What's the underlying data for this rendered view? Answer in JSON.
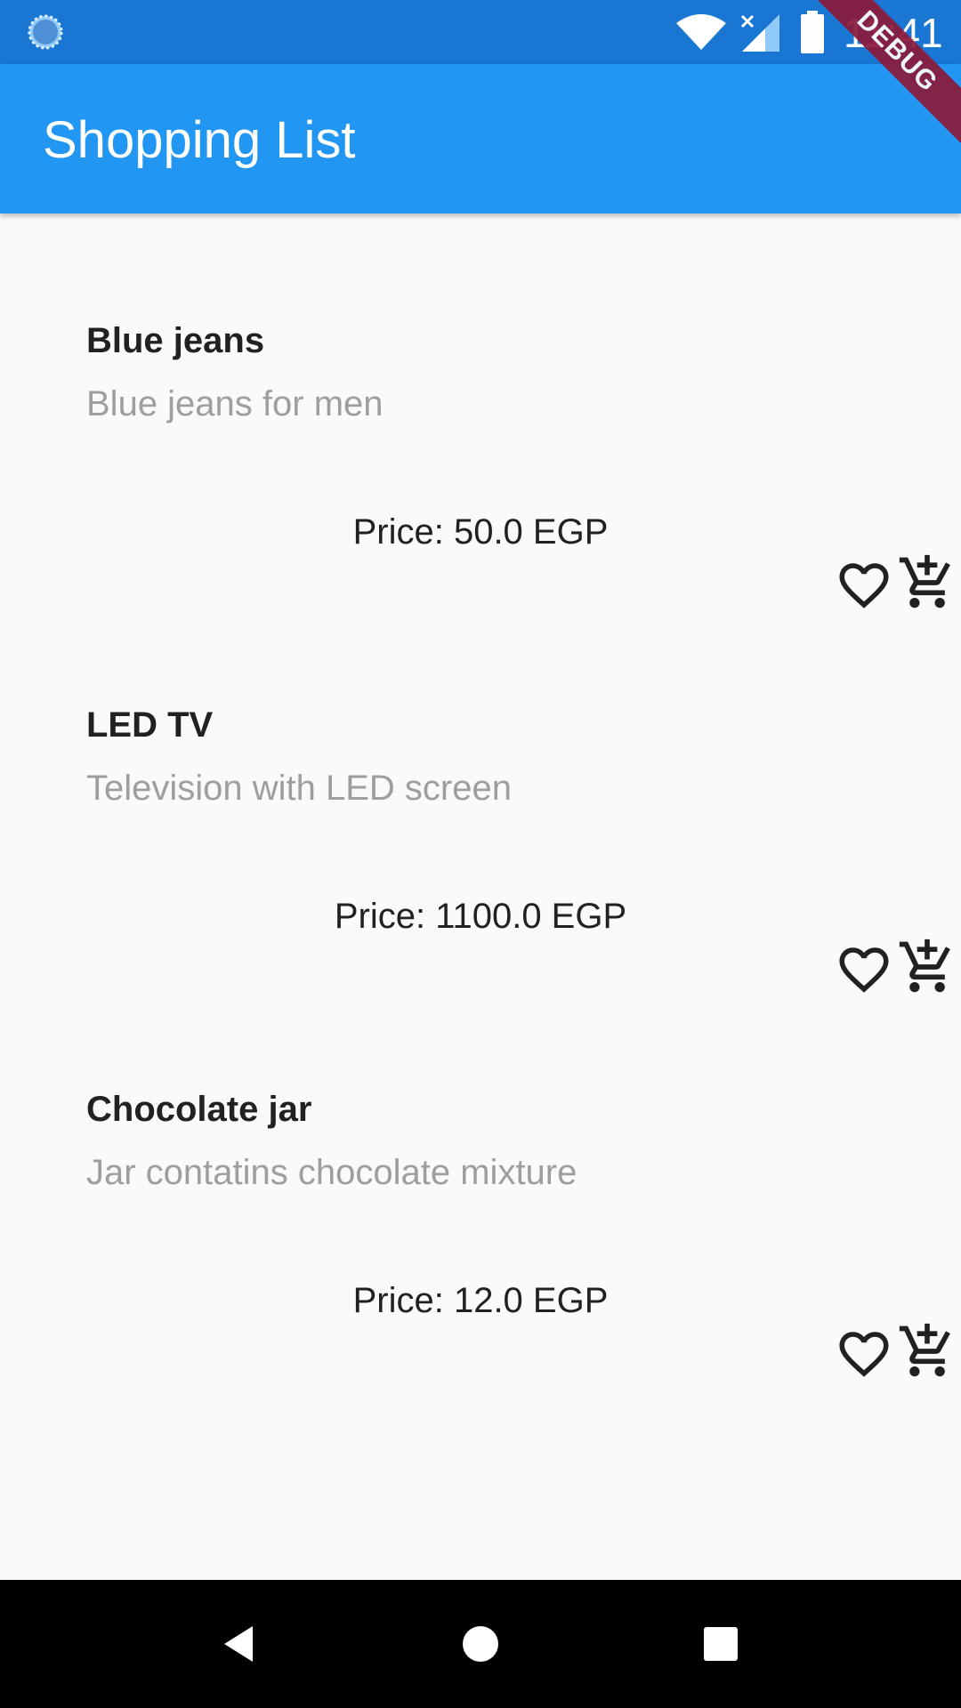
{
  "status_bar": {
    "time": "11:41",
    "icons": [
      "loader-icon",
      "wifi-icon",
      "signal-icon",
      "battery-icon"
    ]
  },
  "debug_banner": {
    "label": "DEBUG"
  },
  "app_bar": {
    "title": "Shopping List",
    "color": "#2196f3"
  },
  "products": [
    {
      "name": "Blue jeans",
      "description": "Blue jeans for men",
      "price": "Price: 50.0 EGP"
    },
    {
      "name": "LED TV",
      "description": "Television with LED screen",
      "price": "Price: 1100.0 EGP"
    },
    {
      "name": "Chocolate jar",
      "description": "Jar contatins chocolate mixture",
      "price": "Price: 12.0 EGP"
    }
  ],
  "card_icons": [
    "favorite-border-icon",
    "add-shopping-cart-icon"
  ],
  "nav_bar": {
    "buttons": [
      "back-icon",
      "home-icon",
      "recents-icon"
    ]
  }
}
